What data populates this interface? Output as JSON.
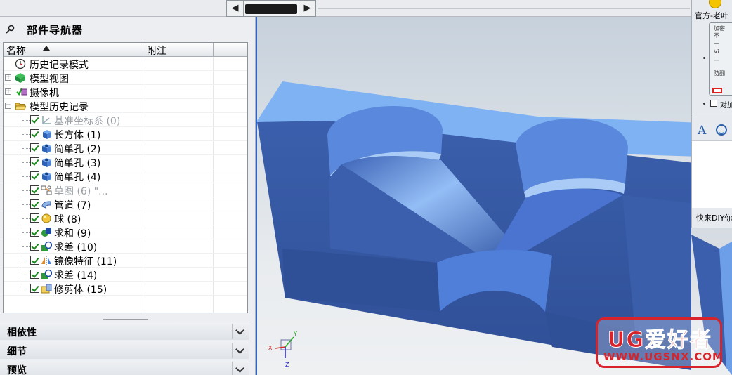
{
  "navigator": {
    "title": "部件导航器",
    "columns": {
      "name": "名称",
      "note": "附注"
    },
    "rows": [
      {
        "label": "历史记录模式",
        "icon": "clock-icon",
        "kind": "mode"
      },
      {
        "label": "模型视图",
        "icon": "model-views-icon",
        "kind": "group",
        "expander": "+"
      },
      {
        "label": "摄像机",
        "icon": "camera-icon",
        "kind": "group",
        "expander": "+"
      },
      {
        "label": "模型历史记录",
        "icon": "folder-open-icon",
        "kind": "group",
        "expander": "−"
      },
      {
        "label": "基准坐标系 (0)",
        "icon": "datum-csys-icon",
        "kind": "feature",
        "dim": true
      },
      {
        "label": "长方体 (1)",
        "icon": "block-icon",
        "kind": "feature"
      },
      {
        "label": "简单孔 (2)",
        "icon": "hole-icon",
        "kind": "feature"
      },
      {
        "label": "简单孔 (3)",
        "icon": "hole-icon",
        "kind": "feature"
      },
      {
        "label": "简单孔 (4)",
        "icon": "hole-icon",
        "kind": "feature"
      },
      {
        "label": "草图 (6) \"...",
        "icon": "sketch-icon",
        "kind": "feature",
        "dim": true
      },
      {
        "label": "管道 (7)",
        "icon": "tube-icon",
        "kind": "feature"
      },
      {
        "label": "球 (8)",
        "icon": "sphere-icon",
        "kind": "feature"
      },
      {
        "label": "求和 (9)",
        "icon": "unite-icon",
        "kind": "feature"
      },
      {
        "label": "求差 (10)",
        "icon": "subtract-icon",
        "kind": "feature"
      },
      {
        "label": "镜像特征 (11)",
        "icon": "mirror-icon",
        "kind": "feature"
      },
      {
        "label": "求差 (14)",
        "icon": "subtract-icon",
        "kind": "feature"
      },
      {
        "label": "修剪体 (15)",
        "icon": "trim-body-icon",
        "kind": "feature"
      }
    ]
  },
  "sections": [
    {
      "label": "相依性"
    },
    {
      "label": "细节"
    },
    {
      "label": "预览"
    }
  ],
  "chat_panel": {
    "title": "官方-老叶",
    "options_group": [
      "加密",
      "不",
      "一",
      "Vi",
      "一"
    ],
    "sub_group": "防翻",
    "checkbox_label": "对加",
    "bottom_text": "快来DIY你"
  },
  "watermark": {
    "text": "UG爱好者",
    "url": "WWW.UGSNX.COM"
  },
  "colors": {
    "model_face_top": "#7fb0f0",
    "model_face_side": "#3b5ea8",
    "model_face_hole": "#4f7fd8",
    "viewport_bg": "#dfe4ea",
    "watermark_red": "#d8232a"
  }
}
